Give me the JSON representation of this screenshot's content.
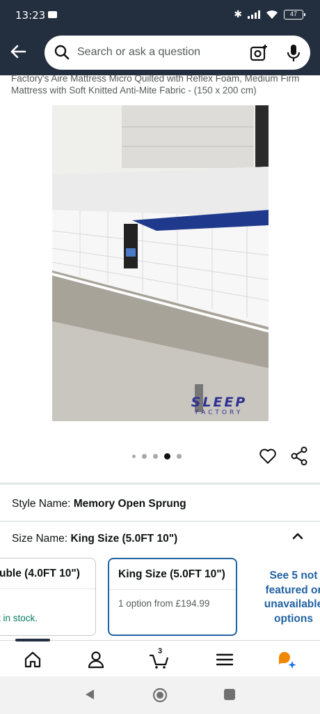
{
  "status_bar": {
    "time": "13:23",
    "battery": "47"
  },
  "search": {
    "placeholder": "Search or ask a question"
  },
  "product": {
    "title": "Factory's Aire Mattress Micro Quilted with Reflex Foam, Medium Firm Mattress with Soft Knitted Anti-Mite Fabric - (150 x 200 cm)",
    "watermark_line1": "SLEEP",
    "watermark_line2": "FACTORY",
    "carousel": {
      "count": 5,
      "active_index": 3
    }
  },
  "style": {
    "label": "Style Name:",
    "value": "Memory Open Sprung"
  },
  "size": {
    "label": "Size Name:",
    "value": "King Size (5.0FT 10\")"
  },
  "size_options": [
    {
      "name": "uble (4.0FT 10\")",
      "detail": "t in stock."
    },
    {
      "name": "King Size (5.0FT 10\")",
      "detail": "1 option from £194.99",
      "selected": true
    }
  ],
  "more_options": "See 5 not featured or unavailable options",
  "tab_bar": {
    "cart_count": "3"
  },
  "colors": {
    "header": "#232f3e",
    "link": "#2162a1",
    "in_stock": "#067d62"
  }
}
